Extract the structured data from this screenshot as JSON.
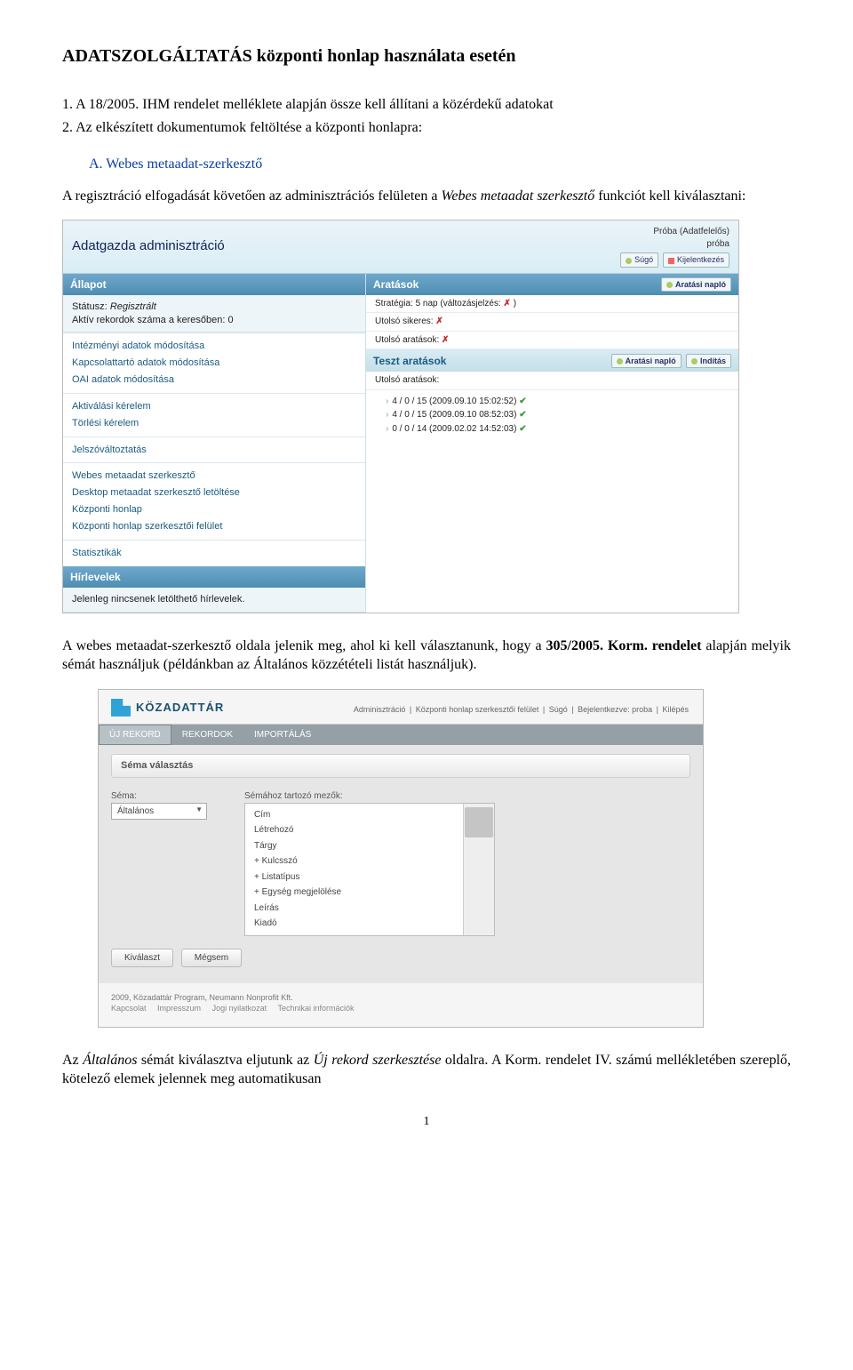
{
  "title": "ADATSZOLGÁLTATÁS központi honlap használata esetén",
  "list": {
    "item1": "1. A 18/2005. IHM rendelet melléklete alapján össze kell állítani a közérdekű adatokat",
    "item2": "2. Az elkészített dokumentumok feltöltése a központi honlapra:"
  },
  "subheading": "A. Webes metaadat-szerkesztő",
  "para1_a": "A regisztráció elfogadását követően az adminisztrációs felületen a ",
  "para1_b": "Webes metaadat szerkesztő",
  "para1_c": " funkciót kell kiválasztani:",
  "shot1": {
    "title": "Adatgazda adminisztráció",
    "user_line": "Próba (Adatfelelős)",
    "user_sub": "próba",
    "btn_help": "Súgó",
    "btn_logout": "Kijelentkezés",
    "allapot": "Állapot",
    "status_label": "Státusz:",
    "status_value": "Regisztrált",
    "aktiv_line": "Aktív rekordok száma a keresőben: 0",
    "links_g1": [
      "Intézményi adatok módosítása",
      "Kapcsolattartó adatok módosítása",
      "OAI adatok módosítása"
    ],
    "links_g2": [
      "Aktiválási kérelem",
      "Törlési kérelem"
    ],
    "links_g3": [
      "Jelszóváltoztatás"
    ],
    "links_g4": [
      "Webes metaadat szerkesztő",
      "Desktop metaadat szerkesztő letöltése",
      "Központi honlap",
      "Központi honlap szerkesztői felület"
    ],
    "links_g5": [
      "Statisztikák"
    ],
    "hirlevelek": "Hírlevelek",
    "hir_body": "Jelenleg nincsenek letölthető hírlevelek.",
    "aratasok": "Aratások",
    "aratasi_naplo": "Aratási napló",
    "strat": "Stratégia: 5 nap (változásjelzés:",
    "utolso_sikeres": "Utolsó sikeres:",
    "utolso_aratasok": "Utolsó aratások:",
    "teszt": "Teszt aratások",
    "inditas": "Indítás",
    "rows": [
      "4 / 0 / 15 (2009.09.10 15:02:52)",
      "4 / 0 / 15 (2009.09.10 08:52:03)",
      "0 / 0 / 14 (2009.02.02 14:52:03)"
    ]
  },
  "para2_a": "A webes metaadat-szerkesztő oldala jelenik meg, ahol ki kell választanunk, hogy a ",
  "para2_b": "305/2005. Korm. rendelet",
  "para2_c": " alapján melyik sémát használjuk (példánkban az Általános közzétételi listát használjuk).",
  "shot2": {
    "logo": "KÖZADATTÁR",
    "toplinks": [
      "Adminisztráció",
      "Központi honlap szerkesztői felület",
      "Súgó",
      "Bejelentkezve: proba",
      "Kilépés"
    ],
    "tab_uj": "ÚJ REKORD",
    "tab_rek": "REKORDOK",
    "tab_imp": "IMPORTÁLÁS",
    "panel_title": "Séma választás",
    "sema_label": "Séma:",
    "sema_value": "Általános",
    "mezok_label": "Sémához tartozó mezők:",
    "fields": [
      "Cím",
      "Létrehozó",
      "Tárgy",
      "+ Kulcsszó",
      "+ Listatípus",
      "+ Egység megjelölése",
      "Leírás",
      "Kiadó"
    ],
    "btn_select": "Kiválaszt",
    "btn_cancel": "Mégsem",
    "footer_line1": "2009, Közadattár Program, Neumann Nonprofit Kft.",
    "footer_links": [
      "Kapcsolat",
      "Impresszum",
      "Jogi nyilatkozat",
      "Technikai információk"
    ]
  },
  "para3_a": "Az ",
  "para3_b": "Általános",
  "para3_c": " sémát kiválasztva eljutunk az ",
  "para3_d": "Új rekord szerkesztése",
  "para3_e": " oldalra. A Korm. rendelet IV. számú mellékletében szereplő, kötelező elemek jelennek meg automatikusan",
  "page_number": "1"
}
